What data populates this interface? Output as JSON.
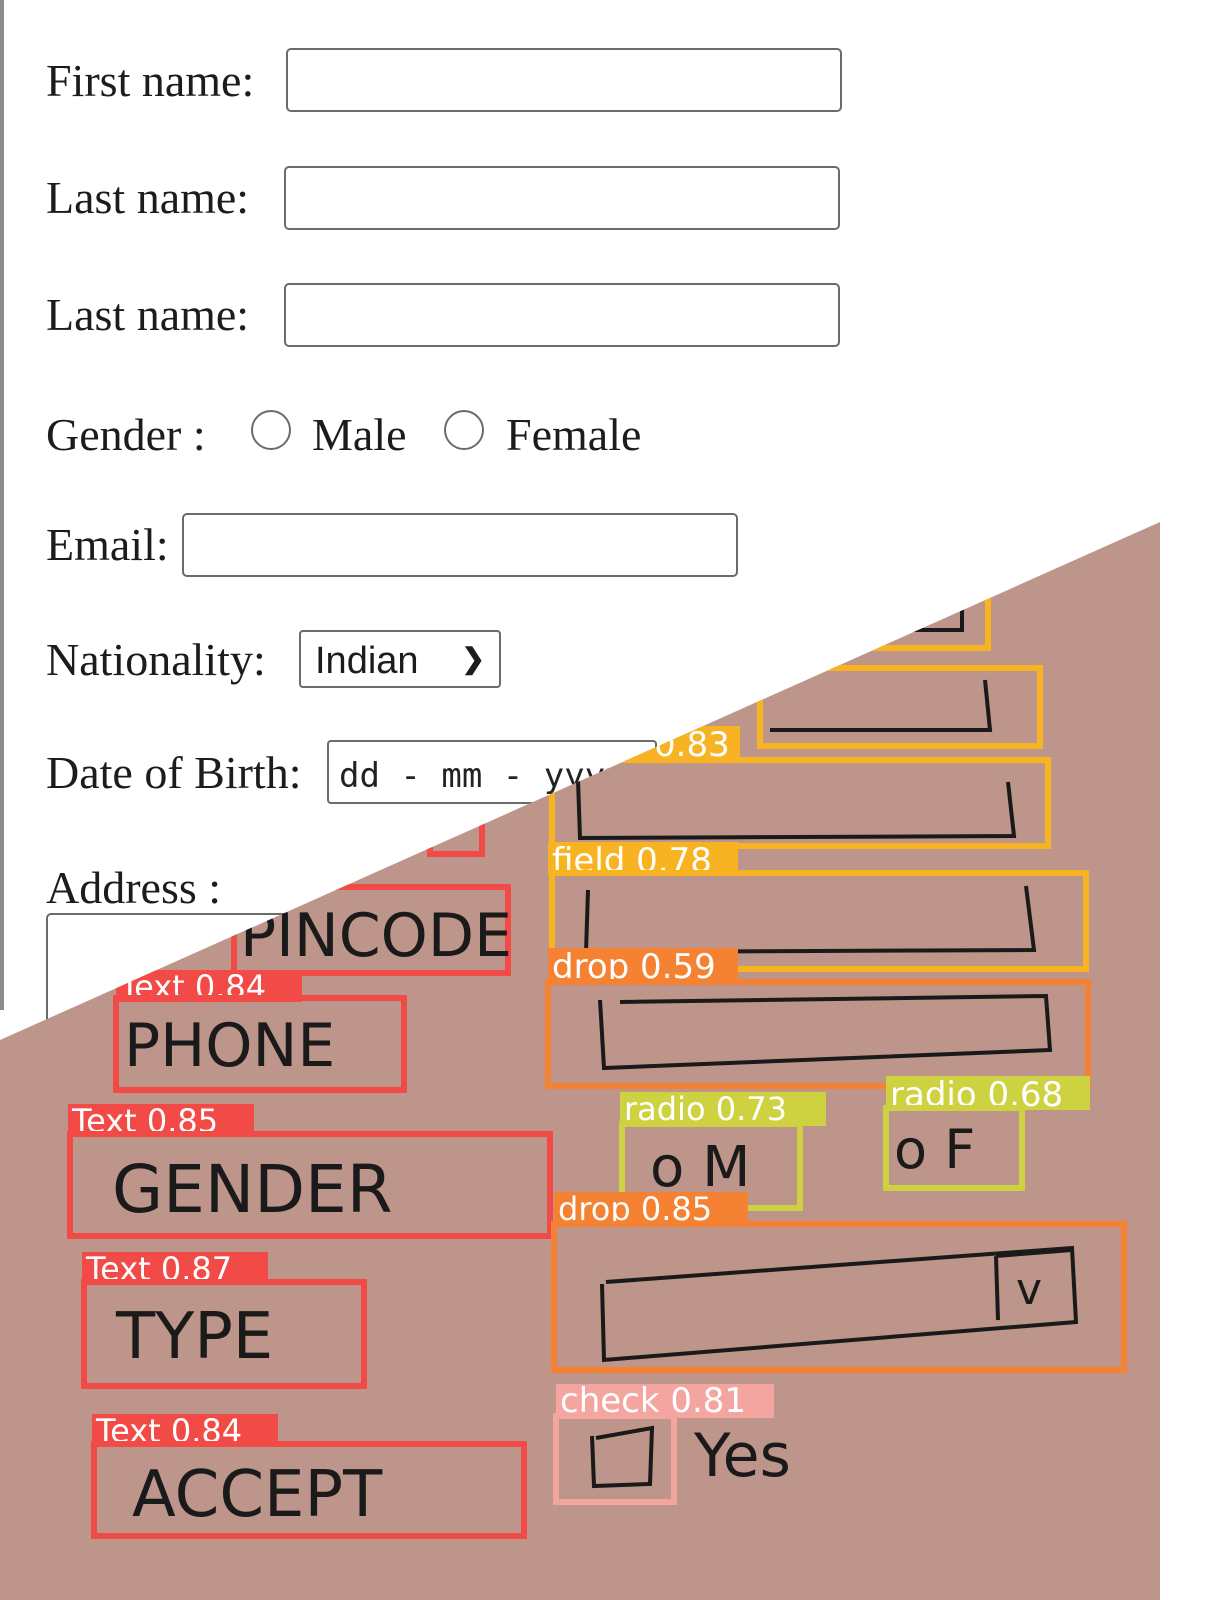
{
  "form": {
    "first_name_label": "First name:",
    "last_name_label": "Last name:",
    "last_name_label_2": "Last name:",
    "gender_label": "Gender :",
    "gender_options": [
      "Male",
      "Female"
    ],
    "email_label": "Email:",
    "nationality_label": "Nationality:",
    "nationality_value": "Indian",
    "dob_label": "Date of Birth:",
    "dob_placeholder": "dd - mm - yyyy",
    "address_label": "Address :"
  },
  "sketch": {
    "background_color": "#bd958a",
    "detections": {
      "text_pincode": "PINCODE",
      "text_phone_label": "Text 0.84",
      "text_phone": "PHONE",
      "text_gender_label": "Text 0.85",
      "text_gender": "GENDER",
      "text_type_label": "Text 0.87",
      "text_type": "TYPE",
      "text_accept_label": "Text 0.84",
      "text_accept": "ACCEPT",
      "field_083_label": "0.83",
      "field_078_label": "field 0.78",
      "drop_059_label": "drop 0.59",
      "radio_073_label": "radio 0.73",
      "radio_073_text": "o M",
      "radio_068_label": "radio 0.68",
      "radio_068_text": "o F",
      "drop_085_label": "drop 0.85",
      "drop_085_arrow": "v",
      "check_081_label": "check 0.81",
      "check_yes_text": "Yes"
    },
    "colors": {
      "text_box": "#f24a46",
      "field_box": "#f7b322",
      "drop_box": "#f58232",
      "radio_box": "#cfd240",
      "check_box": "#f5a5a0"
    }
  }
}
